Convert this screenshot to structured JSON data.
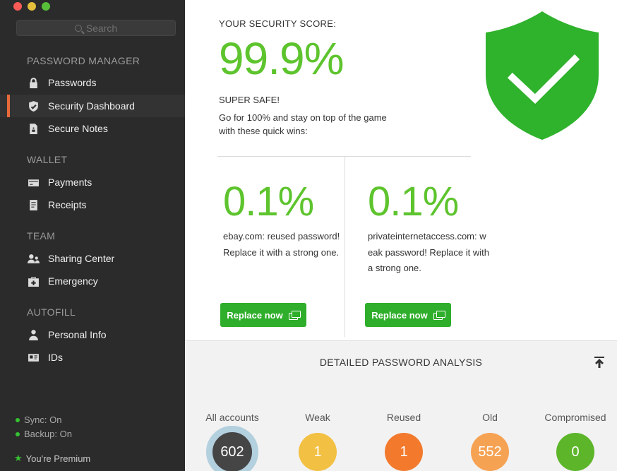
{
  "sidebar": {
    "search_placeholder": "Search",
    "sections": {
      "password_manager": "PASSWORD MANAGER",
      "wallet": "WALLET",
      "team": "TEAM",
      "autofill": "AUTOFILL"
    },
    "items": {
      "passwords": {
        "label": "Passwords",
        "icon": "lock-icon"
      },
      "security_dashboard": {
        "label": "Security Dashboard",
        "icon": "shield-icon"
      },
      "secure_notes": {
        "label": "Secure Notes",
        "icon": "note-icon"
      },
      "payments": {
        "label": "Payments",
        "icon": "credit-card-icon"
      },
      "receipts": {
        "label": "Receipts",
        "icon": "receipt-icon"
      },
      "sharing_center": {
        "label": "Sharing Center",
        "icon": "people-icon"
      },
      "emergency": {
        "label": "Emergency",
        "icon": "first-aid-icon"
      },
      "personal_info": {
        "label": "Personal Info",
        "icon": "person-icon"
      },
      "ids": {
        "label": "IDs",
        "icon": "id-card-icon"
      }
    },
    "status": {
      "sync": "Sync: On",
      "backup": "Backup: On",
      "premium": "You're Premium"
    }
  },
  "main": {
    "score_label": "YOUR SECURITY SCORE:",
    "score_value": "99.9%",
    "safe_label": "SUPER SAFE!",
    "safe_desc": "Go for 100% and stay on top of the game with these quick wins:",
    "quick_wins": [
      {
        "value": "0.1%",
        "desc": "ebay.com: reused password! Replace it with a strong one.",
        "button": "Replace now"
      },
      {
        "value": "0.1%",
        "desc": "privateinternetaccess.com: weak password! Replace it with a strong one.",
        "button": "Replace now"
      }
    ],
    "analysis": {
      "title": "DETAILED PASSWORD ANALYSIS",
      "stats": [
        {
          "label": "All accounts",
          "value": "602",
          "color": "#454545"
        },
        {
          "label": "Weak",
          "value": "1",
          "color": "#f2c042"
        },
        {
          "label": "Reused",
          "value": "1",
          "color": "#f37a2d"
        },
        {
          "label": "Old",
          "value": "552",
          "color": "#f6a253"
        },
        {
          "label": "Compromised",
          "value": "0",
          "color": "#5db52a"
        }
      ]
    }
  },
  "colors": {
    "accent_green": "#5ec42e",
    "button_green": "#2fae2b",
    "sidebar_bg": "#2b2b2b",
    "active_marker": "#e86a3a"
  }
}
